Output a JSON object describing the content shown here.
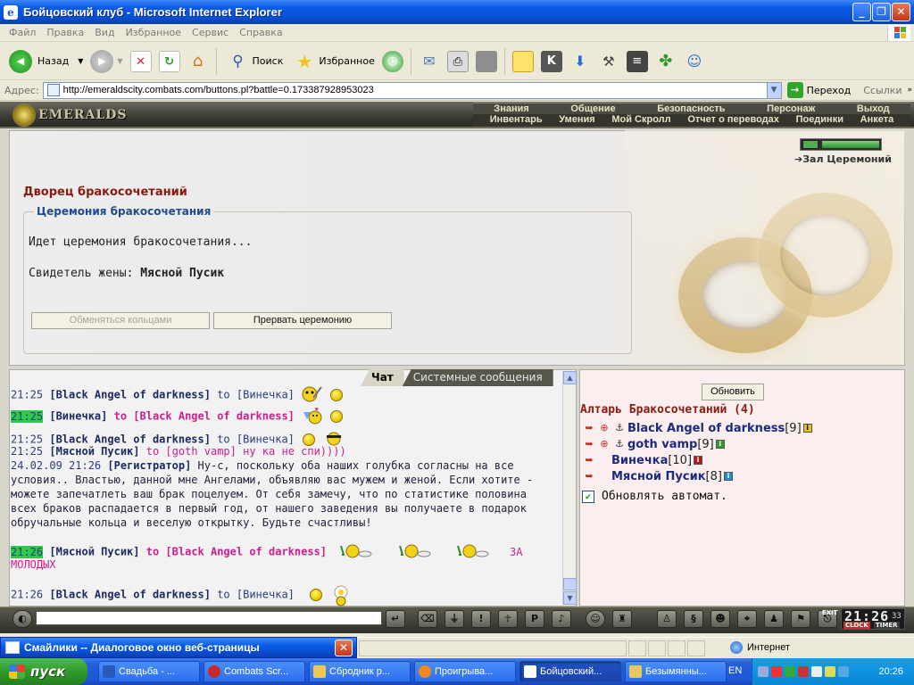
{
  "window": {
    "title": "Бойцовский клуб - Microsoft Internet Explorer"
  },
  "menu": [
    "Файл",
    "Правка",
    "Вид",
    "Избранное",
    "Сервис",
    "Справка"
  ],
  "toolbar": {
    "back": "Назад",
    "search": "Поиск",
    "favorites": "Избранное"
  },
  "address": {
    "label": "Адрес:",
    "url": "http://emeraldscity.combats.com/buttons.pl?battle=0.173387928953023",
    "go": "Переход",
    "links": "Ссылки"
  },
  "game": {
    "logo": "EMERALDS",
    "nav_top": [
      "Знания",
      "Общение",
      "Безопасность",
      "Персонаж",
      "Выход"
    ],
    "nav_bottom": [
      "Инвентарь",
      "Умения",
      "Мой Скролл",
      "Отчет о переводах",
      "Поединки",
      "Анкета"
    ],
    "location_link": "Зал Церемоний",
    "hp_fraction": 1.0
  },
  "ceremony": {
    "palace": "Дворец бракосочетаний",
    "section": "Церемония бракосочетания",
    "status": "Идет церемония бракосочетания...",
    "witness_label": "Свидетель жены:",
    "witness_name": "Мясной Пусик",
    "btn_exchange": "Обменяться кольцами",
    "btn_interrupt": "Прервать церемонию"
  },
  "chat": {
    "tabs": [
      "Чат",
      "Системные сообщения"
    ],
    "lines": [
      {
        "time": "21:25",
        "from": "[Black Angel of darkness]",
        "to": " to [Винечка]"
      },
      {
        "time": "21:25",
        "from": "[Винечка]",
        "to": " to [Black Angel of darkness]"
      },
      {
        "time": "21:25",
        "from": "[Black Angel of darkness]",
        "to": " to [Винечка]"
      },
      {
        "time": "21:25",
        "from": "[Мясной Пусик]",
        "to": " to [goth vamp]",
        "text": " ну ка не спи))))"
      },
      {
        "time": "24.02.09 21:26",
        "from": "[Регистратор]",
        "text": " Ну-с, поскольку оба наших голубка согласны на все"
      },
      {
        "text": "условия.. Властью, данной мне Ангелами, объявляю вас мужем и женой. Если хотите -"
      },
      {
        "text": "можете запечатлеть ваш брак поцелуем. От себя замечу, что по статистике половина"
      },
      {
        "text": "всех браков распадается в первый год, от нашего заведения вы получаете в подарок"
      },
      {
        "text": "обручальные кольца и веселую открытку. Будьте счастливы!"
      },
      {
        "time": "21:26",
        "from": "[Мясной Пусик]",
        "to": " to [Black Angel of darkness]",
        "text": "ЗА"
      },
      {
        "text": "МОЛОДЫХ"
      },
      {
        "time": "21:26",
        "from": "[Black Angel of darkness]",
        "to": " to [Винечка]"
      }
    ]
  },
  "altar": {
    "refresh": "Обновить",
    "title": "Алтарь Бракосочетаний (4)",
    "players": [
      {
        "name": "Black Angel of darkness",
        "level": "[9]"
      },
      {
        "name": "goth vamp",
        "level": "[9]"
      },
      {
        "name": "Винечка",
        "level": "[10]"
      },
      {
        "name": "Мясной Пусик",
        "level": "[8]"
      }
    ],
    "auto_refresh": "Обновлять автомат.",
    "auto_refresh_checked": true
  },
  "clock": {
    "time": "21:26",
    "seconds": "33",
    "clock_label": "CLOCK",
    "timer_label": "TIMER",
    "exit": "EXIT"
  },
  "popup": {
    "title": "Смайлики -- Диалоговое окно веб-страницы"
  },
  "status": {
    "zone": "Интернет"
  },
  "taskbar": {
    "start": "пуск",
    "tasks": [
      "Свадьба - ...",
      "Combats Scr...",
      "Сбродник р...",
      "Проигрыва...",
      "Бойцовский...",
      "Безымянны..."
    ],
    "lang": "EN",
    "time": "20:26"
  },
  "colors": {
    "accent_red": "#8b1a10",
    "nick_blue": "#1c2a60",
    "private_pink": "#cc1f8e",
    "time_highlight": "#2ec94a"
  }
}
